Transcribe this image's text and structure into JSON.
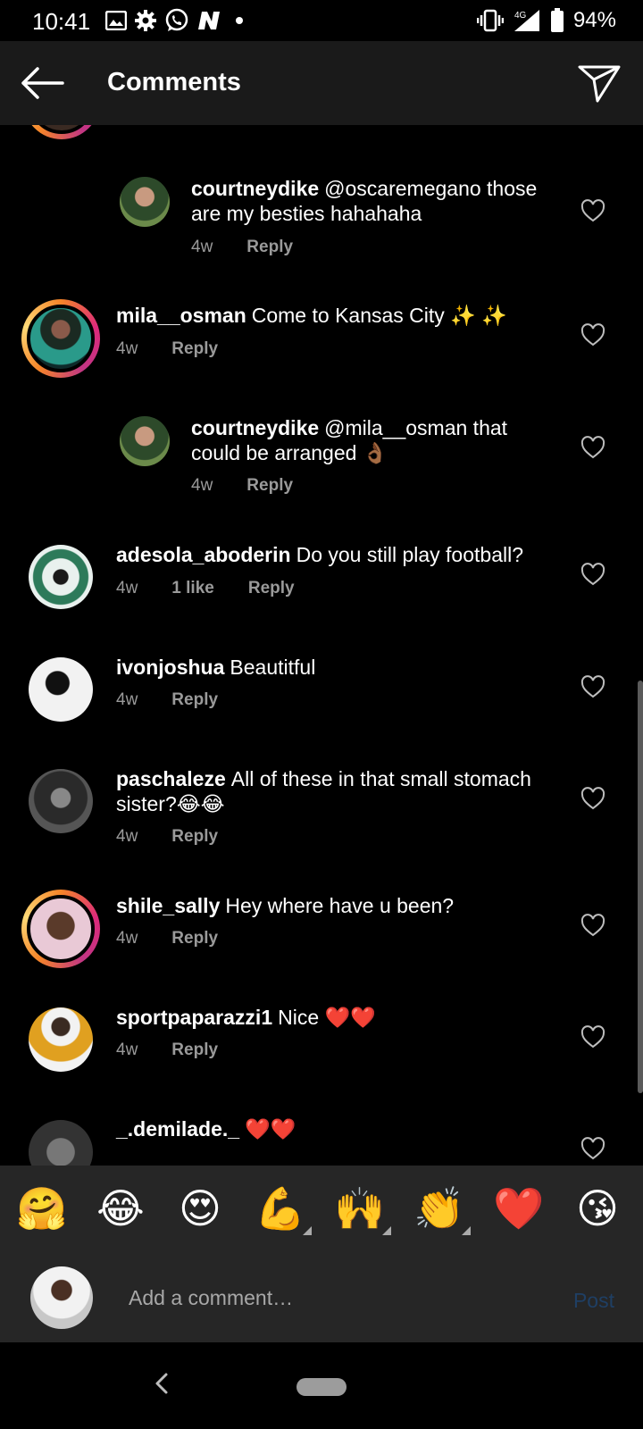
{
  "status_bar": {
    "time": "10:41",
    "network": "4G",
    "battery": "94%",
    "icons": [
      "image-icon",
      "gear-icon",
      "whatsapp-icon",
      "n-icon",
      "dot-icon",
      "vibrate-icon",
      "signal-icon",
      "battery-icon"
    ]
  },
  "header": {
    "title": "Comments",
    "back_icon": "arrow-left-icon",
    "share_icon": "paper-plane-icon"
  },
  "comments": [
    {
      "user": "courtneydike",
      "text": "@oscaremegano those are my besties hahahaha",
      "time": "4w",
      "likes": "",
      "reply_label": "Reply",
      "reply": true
    },
    {
      "user": "mila__osman",
      "text": "Come to Kansas City ✨ ✨",
      "time": "4w",
      "likes": "",
      "reply_label": "Reply",
      "reply": false
    },
    {
      "user": "courtneydike",
      "text": "@mila__osman that could be arranged 👌🏾",
      "time": "4w",
      "likes": "",
      "reply_label": "Reply",
      "reply": true
    },
    {
      "user": "adesola_aboderin",
      "text": "Do you still play football?",
      "time": "4w",
      "likes": "1 like",
      "reply_label": "Reply",
      "reply": false
    },
    {
      "user": "ivonjoshua",
      "text": "Beautitful",
      "time": "4w",
      "likes": "",
      "reply_label": "Reply",
      "reply": false
    },
    {
      "user": "paschaleze",
      "text": "All of these in that small stomach sister?😂😂",
      "time": "4w",
      "likes": "",
      "reply_label": "Reply",
      "reply": false
    },
    {
      "user": "shile_sally",
      "text": "Hey where have u been?",
      "time": "4w",
      "likes": "",
      "reply_label": "Reply",
      "reply": false
    },
    {
      "user": "sportpaparazzi1",
      "text": "Nice ❤️❤️",
      "time": "4w",
      "likes": "",
      "reply_label": "Reply",
      "reply": false
    },
    {
      "user": "_.demilade._",
      "text": "❤️❤️",
      "time": "",
      "likes": "",
      "reply_label": "",
      "reply": false
    }
  ],
  "emoji_bar": [
    "🤗",
    "😂",
    "😍",
    "💪",
    "🙌",
    "👏",
    "❤️",
    "😘"
  ],
  "input": {
    "placeholder": "Add a comment…",
    "post_label": "Post"
  },
  "colors": {
    "background": "#000000",
    "header": "#1a1a1a",
    "secondary_text": "#9a9a9a",
    "post_disabled": "#1f3f64",
    "story_ring": "#dd2a7b"
  }
}
